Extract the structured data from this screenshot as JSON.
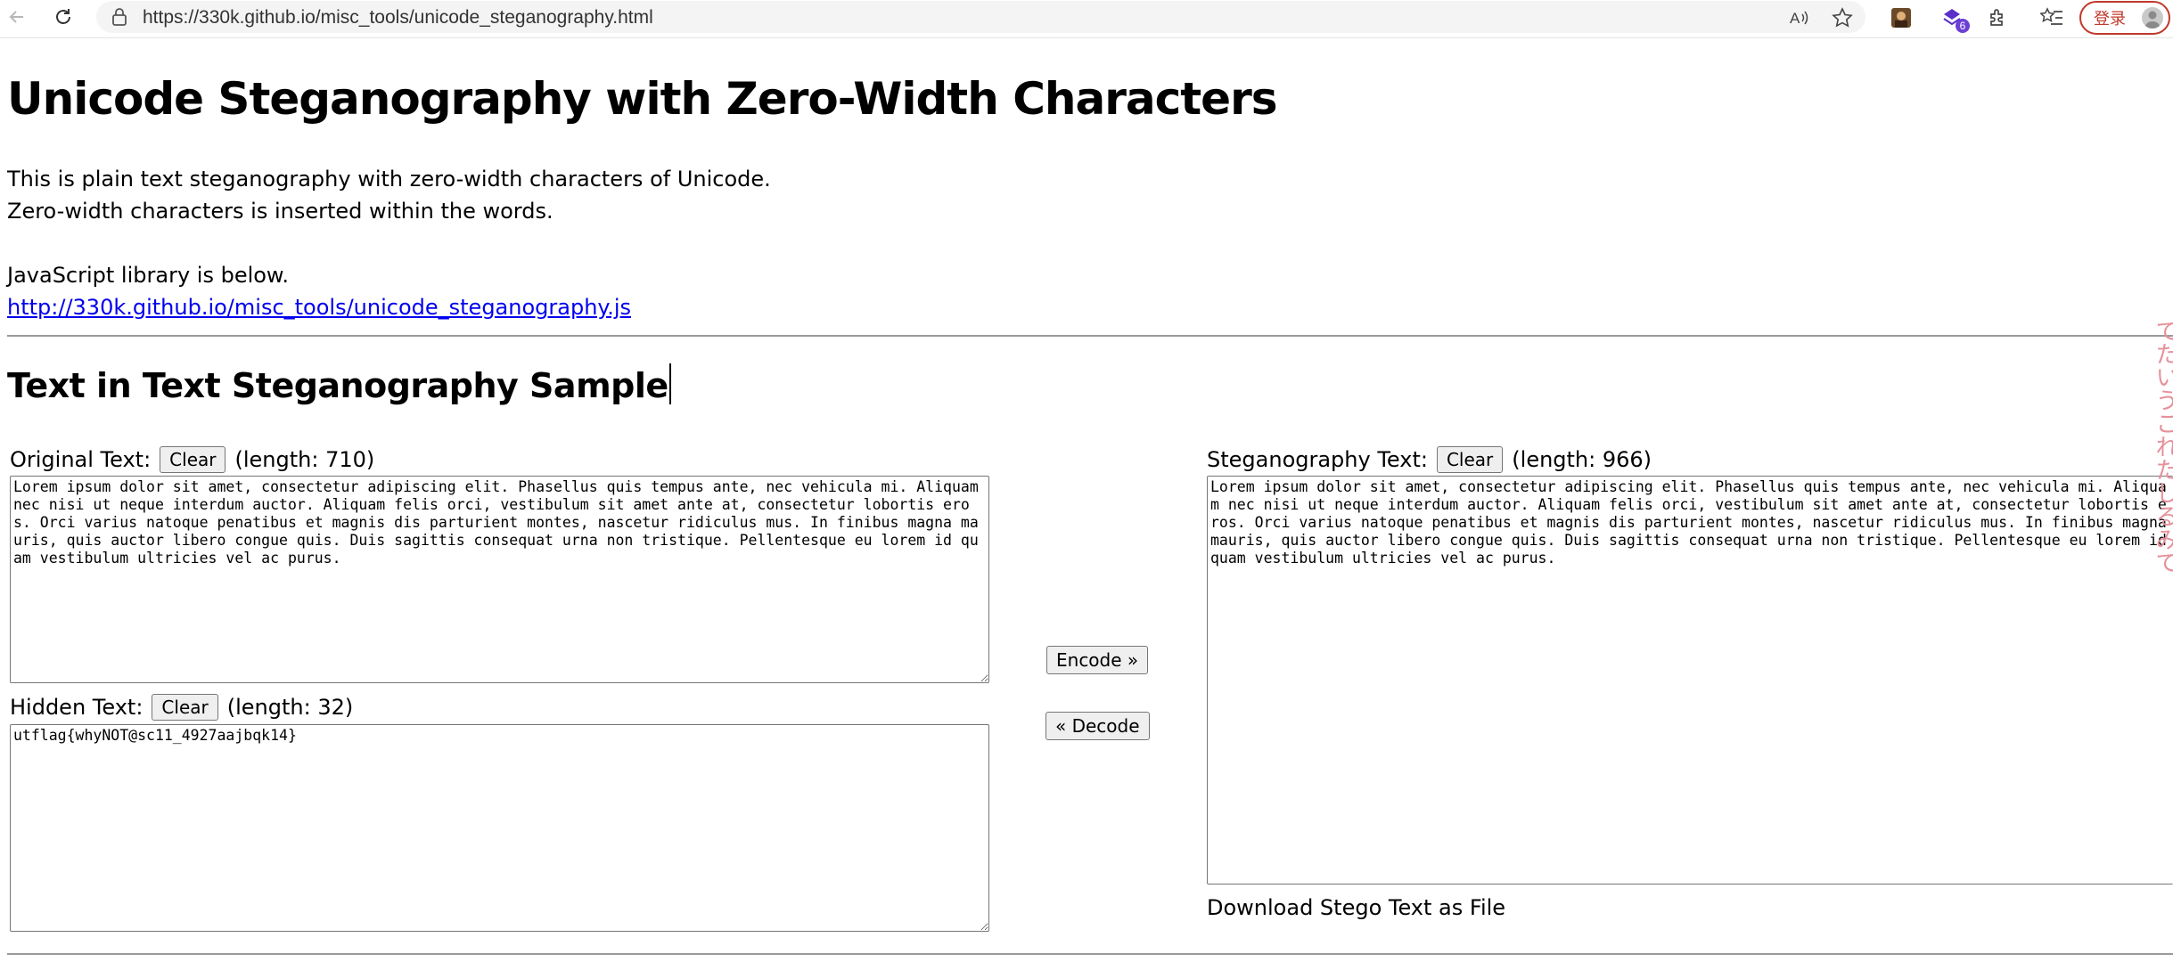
{
  "browser": {
    "url": "https://330k.github.io/misc_tools/unicode_steganography.html",
    "extension_badge": "6",
    "login_label": "登录"
  },
  "page": {
    "title": "Unicode Steganography with Zero-Width Characters",
    "intro_line1": "This is plain text steganography with zero-width characters of Unicode.",
    "intro_line2": "Zero-width characters is inserted within the words.",
    "library_text": "JavaScript library is below.",
    "library_link": "http://330k.github.io/misc_tools/unicode_steganography.js",
    "section_title": "Text in Text Steganography Sample"
  },
  "original": {
    "label": "Original Text:",
    "clear_label": "Clear",
    "length": "(length: 710)",
    "value": "Lorem ipsum dolor sit amet, consectetur adipiscing elit. Phasellus quis tempus ante, nec vehicula mi. Aliquam nec nisi ut neque interdum auctor. Aliquam felis orci, vestibulum sit amet ante at, consectetur lobortis eros. Orci varius natoque penatibus et magnis dis parturient montes, nascetur ridiculus mus. In finibus magna mauris, quis auctor libero congue quis. Duis sagittis consequat urna non tristique. Pellentesque eu lorem id quam vestibulum ultricies vel ac purus."
  },
  "hidden": {
    "label": "Hidden Text:",
    "clear_label": "Clear",
    "length": "(length: 32)",
    "value": "utflag{whyNOT@sc11_4927aajbqk14}"
  },
  "actions": {
    "encode_label": "Encode »",
    "decode_label": "« Decode"
  },
  "stego": {
    "label": "Steganography Text:",
    "clear_label": "Clear",
    "length": "(length: 966)",
    "value": "Lorem ipsum dolor sit amet, consectetur adipiscing elit. Phasellus quis tempus ante, nec vehicula mi. Aliquam nec nisi ut neque interdum auctor. Aliquam felis orci, vestibulum sit amet ante at, consectetur lobortis eros. Orci varius natoque penatibus et magnis dis parturient montes, nascetur ridiculus mus. In finibus magna mauris, quis auctor libero congue quis. Duis sagittis consequat urna non tristique. Pellentesque eu lorem id quam vestibulum ultricies vel ac purus.",
    "download_label": "Download Stego Text as File"
  },
  "side_decoration": "てたいうこれたしるみて",
  "colors": {
    "link": "#0000ee",
    "login_accent": "#c0392b",
    "side_text": "#e6909a"
  }
}
